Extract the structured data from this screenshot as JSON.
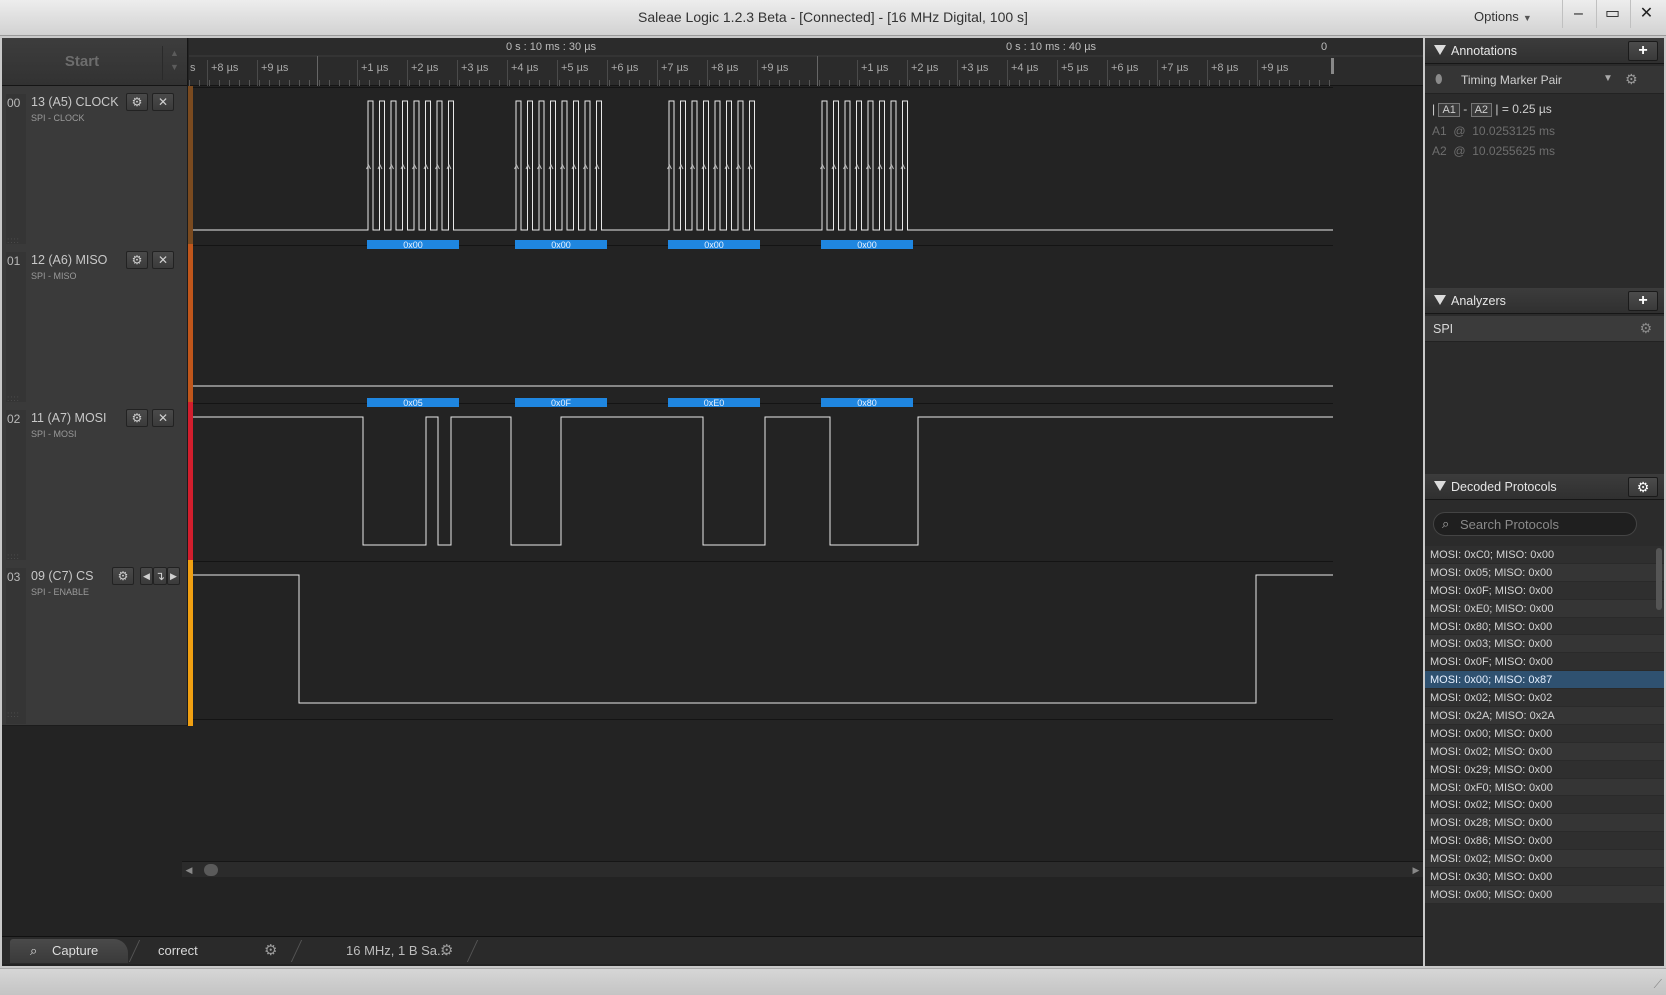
{
  "window": {
    "title": "Saleae Logic 1.2.3 Beta - [Connected] - [16 MHz Digital, 100 s]",
    "options_label": "Options",
    "minimize": "–",
    "maximize": "▭",
    "close": "✕"
  },
  "toolbar": {
    "start_label": "Start"
  },
  "ruler": {
    "major_labels": [
      "0 s : 10 ms : 30 µs",
      "0 s : 10 ms : 40 µs"
    ],
    "right_edge_label": "0",
    "first_tick_label": "s",
    "tick_labels_a": [
      "+8 µs",
      "+9 µs"
    ],
    "tick_labels_b": [
      "+1 µs",
      "+2 µs",
      "+3 µs",
      "+4 µs",
      "+5 µs",
      "+6 µs",
      "+7 µs",
      "+8 µs",
      "+9 µs"
    ],
    "tick_labels_c": [
      "+1 µs",
      "+2 µs",
      "+3 µs",
      "+4 µs",
      "+5 µs",
      "+6 µs",
      "+7 µs",
      "+8 µs",
      "+9 µs"
    ]
  },
  "channels": [
    {
      "index": "00",
      "name": "13 (A5) CLOCK",
      "role": "SPI - CLOCK",
      "color": "#7a4a1f"
    },
    {
      "index": "01",
      "name": "12 (A6) MISO",
      "role": "SPI - MISO",
      "color": "#c0561b"
    },
    {
      "index": "02",
      "name": "11 (A7) MOSI",
      "role": "SPI - MOSI",
      "color": "#d21e2d"
    },
    {
      "index": "03",
      "name": "09 (C7) CS",
      "role": "SPI - ENABLE",
      "color": "#f0a012"
    }
  ],
  "decodes": {
    "miso_bytes": [
      "0x00",
      "0x00",
      "0x00",
      "0x00"
    ],
    "mosi_bytes": [
      "0x05",
      "0x0F",
      "0xE0",
      "0x80"
    ],
    "bubble_color": "#1f86e0"
  },
  "annotations": {
    "title": "Annotations",
    "add": "+",
    "marker_pair": "Timing Marker Pair",
    "marker_a": "A1",
    "marker_b": "A2",
    "delta": "= 0.25 µs",
    "a1_label": "A1",
    "a1_at": "@",
    "a1_time": "10.0253125 ms",
    "a2_label": "A2",
    "a2_at": "@",
    "a2_time": "10.0255625 ms"
  },
  "analyzers": {
    "title": "Analyzers",
    "add": "+",
    "items": [
      "SPI"
    ]
  },
  "decoded_protocols": {
    "title": "Decoded Protocols",
    "search_placeholder": "Search Protocols",
    "selected_index": 7,
    "rows": [
      "MOSI: 0xC0;  MISO: 0x00",
      "MOSI: 0x05;  MISO: 0x00",
      "MOSI: 0x0F;  MISO: 0x00",
      "MOSI: 0xE0;  MISO: 0x00",
      "MOSI: 0x80;  MISO: 0x00",
      "MOSI: 0x03;  MISO: 0x00",
      "MOSI: 0x0F;  MISO: 0x00",
      "MOSI: 0x00;  MISO: 0x87",
      "MOSI: 0x02;  MISO: 0x02",
      "MOSI: 0x2A;  MISO: 0x2A",
      "MOSI: 0x00;  MISO: 0x00",
      "MOSI: 0x02;  MISO: 0x00",
      "MOSI: 0x29;  MISO: 0x00",
      "MOSI: 0xF0;  MISO: 0x00",
      "MOSI: 0x02;  MISO: 0x00",
      "MOSI: 0x28;  MISO: 0x00",
      "MOSI: 0x86;  MISO: 0x00",
      "MOSI: 0x02;  MISO: 0x00",
      "MOSI: 0x30;  MISO: 0x00",
      "MOSI: 0x00;  MISO: 0x00"
    ]
  },
  "tabs": {
    "capture": "Capture",
    "session": "correct",
    "info": "16 MHz, 1 B Sa..."
  },
  "icons": {
    "gear": "gear-icon",
    "close": "close-icon",
    "search": "search-icon",
    "pin": "pin-icon"
  }
}
